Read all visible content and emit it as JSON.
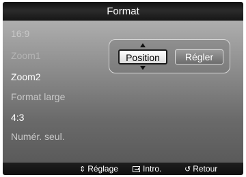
{
  "header": {
    "title": "Format"
  },
  "menu": {
    "items": [
      {
        "label": "16:9",
        "state": "inactive"
      },
      {
        "label": "Zoom1",
        "state": "dim"
      },
      {
        "label": "Zoom2",
        "state": "active"
      },
      {
        "label": "Format large",
        "state": "inactive"
      },
      {
        "label": "4:3",
        "state": "active"
      },
      {
        "label": "Numér. seul.",
        "state": "inactive"
      }
    ]
  },
  "popup": {
    "options": [
      {
        "label": "Position",
        "selected": true
      },
      {
        "label": "Régler",
        "selected": false
      }
    ]
  },
  "footer": {
    "hints": [
      {
        "icon": "up-down-arrows-icon",
        "label": "Réglage"
      },
      {
        "icon": "enter-icon",
        "label": "Intro."
      },
      {
        "icon": "return-icon",
        "label": "Retour"
      }
    ]
  },
  "colors": {
    "title_bar": "#1a1a1a",
    "panel_top": "#aeaeae",
    "panel_bottom": "#5a5a5a",
    "active_text": "#ffffff",
    "inactive_text": "#c9c9c9"
  }
}
